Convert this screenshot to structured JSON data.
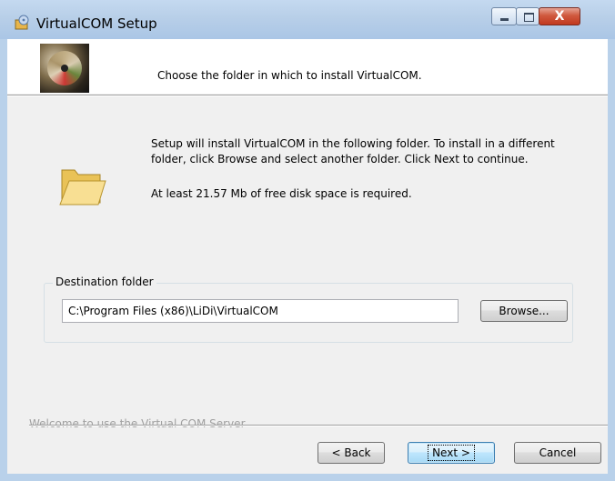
{
  "window": {
    "title": "VirtualCOM Setup",
    "controls": {
      "minimize": "minimize",
      "maximize": "maximize",
      "close": "X"
    }
  },
  "header": {
    "text": "Choose the folder in which to install VirtualCOM."
  },
  "body": {
    "info": "Setup will install VirtualCOM in the following folder. To install in a different folder, click Browse and select another folder. Click Next to continue.",
    "space_required": "At least 21.57 Mb of free disk space is required."
  },
  "destination": {
    "label": "Destination folder",
    "path": "C:\\Program Files (x86)\\LiDi\\VirtualCOM",
    "browse_label": "Browse..."
  },
  "footer": {
    "branding": "Welcome to use the Virtual COM Server",
    "back_label": "< Back",
    "next_label": "Next >",
    "cancel_label": "Cancel"
  },
  "icons": [
    "installer-icon",
    "disc-image",
    "folder-icon",
    "minimize-icon",
    "maximize-icon",
    "close-icon"
  ],
  "colors": {
    "titlebar": "#b8cfe8",
    "client": "#f0f0f0",
    "close": "#c1391f",
    "folder": "#f3d27a"
  }
}
